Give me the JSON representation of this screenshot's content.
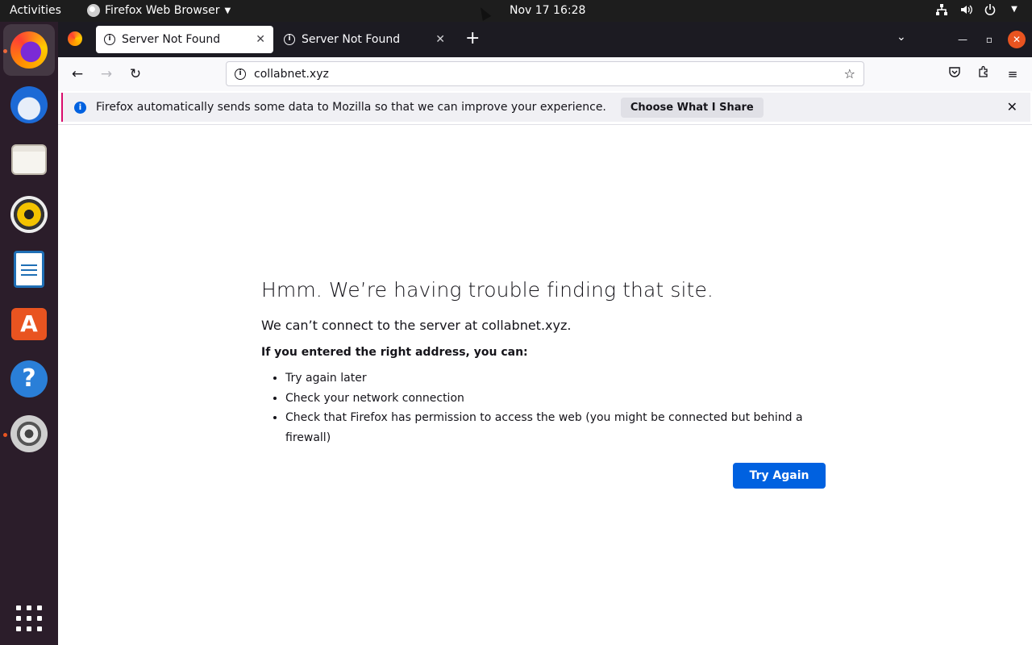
{
  "topbar": {
    "activities": "Activities",
    "app_menu": "Firefox Web Browser",
    "clock": "Nov 17  16:28"
  },
  "dock": {
    "icons": [
      "firefox-icon",
      "thunderbird-icon",
      "files-icon",
      "rhythmbox-icon",
      "libreoffice-writer-icon",
      "app-center-icon",
      "help-icon",
      "settings-icon",
      "show-apps-icon"
    ]
  },
  "tabs": [
    {
      "label": "Server Not Found",
      "selected": true
    },
    {
      "label": "Server Not Found",
      "selected": false
    }
  ],
  "urlbar": {
    "value": "collabnet.xyz"
  },
  "notification": {
    "text": "Firefox automatically sends some data to Mozilla so that we can improve your experience.",
    "button": "Choose What I Share"
  },
  "error": {
    "title": "Hmm. We’re having trouble finding that site.",
    "subtitle": "We can’t connect to the server at collabnet.xyz.",
    "bold": "If you entered the right address, you can:",
    "items": [
      "Try again later",
      "Check your network connection",
      "Check that Firefox has permission to access the web (you might be connected but behind a firewall)"
    ],
    "button": "Try Again"
  },
  "colors": {
    "accent": "#0061e0",
    "ubuntu_orange": "#e95420",
    "tabbar": "#1c1b22"
  }
}
